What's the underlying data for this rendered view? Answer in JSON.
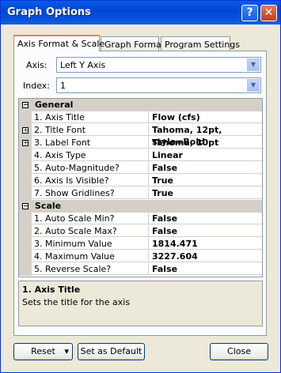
{
  "window": {
    "title": "Graph Options"
  },
  "titlebar": {
    "help_glyph": "?",
    "close_glyph": "✕"
  },
  "tabs": [
    {
      "label": "Axis Format & Scale",
      "active": true
    },
    {
      "label": "Graph Format",
      "active": false
    },
    {
      "label": "Program Settings",
      "active": false
    }
  ],
  "axis": {
    "label": "Axis:",
    "value": "Left Y Axis"
  },
  "index": {
    "label": "Index:",
    "value": "1"
  },
  "dropdown_glyph": "▼",
  "grid": {
    "categories": [
      {
        "title": "General",
        "toggle": "−",
        "props": [
          {
            "name": "1. Axis Title",
            "value": "Flow  (cfs)"
          },
          {
            "name": "2. Title Font",
            "value": "Tahoma, 12pt, style=Bold",
            "expander": "+"
          },
          {
            "name": "3. Label Font",
            "value": "Tahoma, 10pt",
            "expander": "+"
          },
          {
            "name": "4. Axis Type",
            "value": "Linear"
          },
          {
            "name": "5. Auto-Magnitude?",
            "value": "False"
          },
          {
            "name": "6. Axis Is Visible?",
            "value": "True"
          },
          {
            "name": "7. Show Gridlines?",
            "value": "True"
          }
        ]
      },
      {
        "title": "Scale",
        "toggle": "−",
        "props": [
          {
            "name": "1. Auto Scale Min?",
            "value": "False"
          },
          {
            "name": "2. Auto Scale Max?",
            "value": "False"
          },
          {
            "name": "3. Minimum Value",
            "value": "1814.471"
          },
          {
            "name": "4. Maximum Value",
            "value": "3227.604"
          },
          {
            "name": "5. Reverse Scale?",
            "value": "False"
          }
        ]
      }
    ]
  },
  "description": {
    "title": "1. Axis Title",
    "text": "Sets the title for the axis"
  },
  "buttons": {
    "reset": "Reset",
    "reset_arrow": "▾",
    "set_default": "Set as Default",
    "close": "Close"
  }
}
